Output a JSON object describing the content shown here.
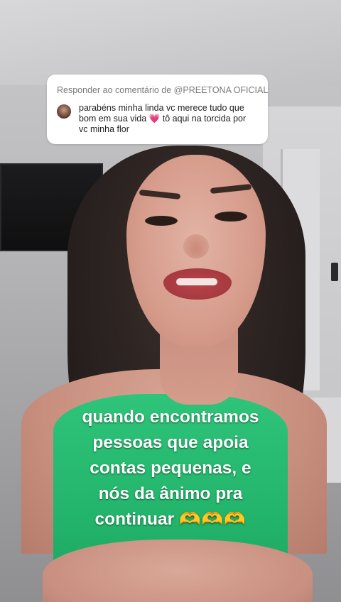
{
  "reply_card": {
    "header": "Responder ao comentário de @PREETONA OFICIAL",
    "comment_before_heart": "parabéns minha linda vc merece tudo que bom em sua vida",
    "heart": "💗",
    "comment_after_heart": "tô aqui na torcida por vc minha flor"
  },
  "caption": {
    "line1": "quando encontramos",
    "line2": "pessoas que apoia",
    "line3": "contas pequenas, e",
    "line4": "nós da ânimo pra",
    "line5_text": "continuar",
    "line5_emoji": "🫶🫶🫶"
  },
  "icons": {
    "avatar": "commenter-avatar",
    "heart": "pink-heart-icon",
    "hands": "heart-hands-emoji"
  },
  "colors": {
    "card_background": "#ffffff",
    "header_text": "#7a7a7a",
    "caption_text": "#ffffff",
    "heart": "#e8457a"
  }
}
